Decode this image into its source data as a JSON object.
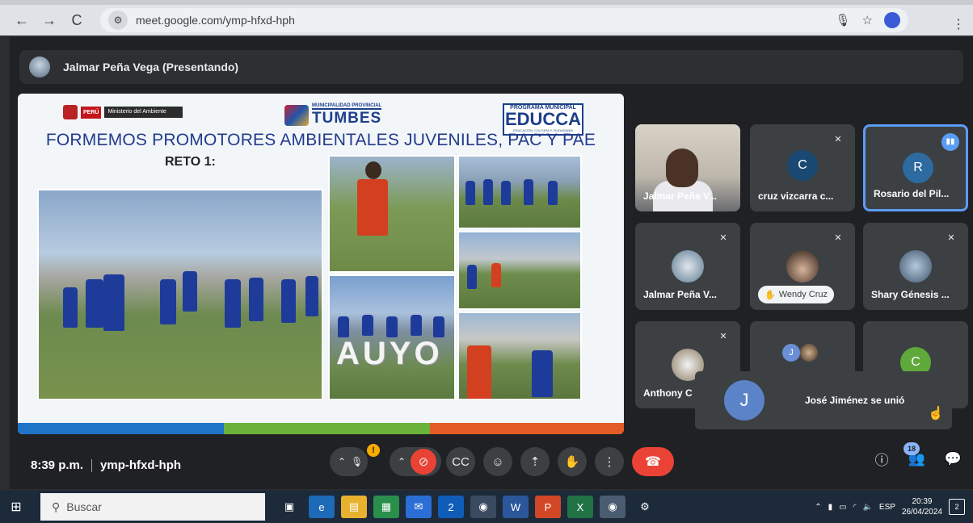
{
  "browser": {
    "url": "meet.google.com/ymp-hfxd-hph",
    "back": "←",
    "forward": "→",
    "reload": "C"
  },
  "presenter": {
    "label": "Jalmar Peña Vega (Presentando)"
  },
  "slide": {
    "peru_label": "PERÚ",
    "ministry_label": "Ministerio del Ambiente",
    "muni_small": "MUNICIPALIDAD PROVINCIAL",
    "muni_big": "TUMBES",
    "educca_small": "PROGRAMA MUNICIPAL",
    "educca_big": "EDUCCA",
    "educca_sub": "EDUCACIÓN, CULTURA Y CIUDADANÍA AMBIENTAL",
    "title": "FORMEMOS PROMOTORES AMBIENTALES JUVENILES, PAC Y PAE",
    "reto": "RETO 1:",
    "auyo": "AUYO"
  },
  "participants": [
    {
      "name": "Jalmar Peña V...",
      "type": "camera",
      "muted": false
    },
    {
      "name": "cruz vizcarra c...",
      "initial": "C",
      "color": "#1a4a73",
      "muted": true
    },
    {
      "name": "Rosario del Pil...",
      "initial": "R",
      "color": "#2c6aa0",
      "speaking": true
    },
    {
      "name": "Jalmar Peña V...",
      "type": "photo",
      "muted": true
    },
    {
      "name": "Wendy Cruz",
      "type": "photo",
      "muted": true,
      "hand_raised": true
    },
    {
      "name": "Shary Génesis ...",
      "type": "photo",
      "muted": true
    },
    {
      "name": "Anthony C",
      "type": "photo",
      "muted": true
    },
    {
      "name": "",
      "type": "group",
      "initial": "J"
    },
    {
      "name": "",
      "initial": "C",
      "color": "#5fa83a"
    }
  ],
  "toast": {
    "initial": "J",
    "text": "José Jiménez se unió"
  },
  "controls": {
    "time": "8:39 p.m.",
    "code": "ymp-hfxd-hph",
    "people_count": "18",
    "warning": "!"
  },
  "taskbar": {
    "search": "Buscar",
    "lang": "ESP",
    "time": "20:39",
    "date": "26/04/2024",
    "notifications": "2",
    "outlook_badge": "2"
  },
  "colors": {
    "accent": "#5b9cf5",
    "end_call": "#ea4335",
    "meet_bg": "#202124"
  }
}
